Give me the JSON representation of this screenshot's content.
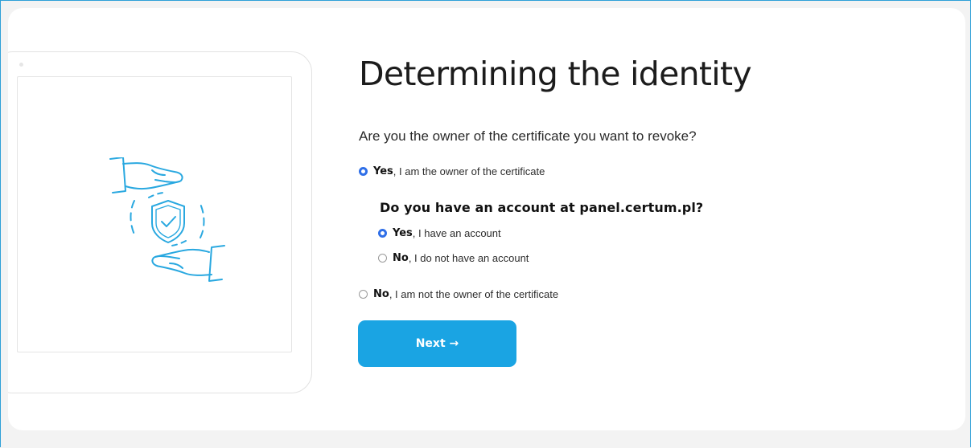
{
  "page": {
    "title": "Determining the identity",
    "question": "Are you the owner of the certificate you want to revoke?"
  },
  "owner_options": {
    "yes": {
      "bold": "Yes",
      "rest": ", I am the owner of the certificate",
      "checked": true
    },
    "no": {
      "bold": "No",
      "rest": ", I am not the owner of the certificate",
      "checked": false
    }
  },
  "account_question": "Do you have an account at panel.certum.pl?",
  "account_options": {
    "yes": {
      "bold": "Yes",
      "rest": ", I have an account",
      "checked": true
    },
    "no": {
      "bold": "No",
      "rest": ", I do not have an account",
      "checked": false
    }
  },
  "next_button": {
    "label": "Next →"
  },
  "illustration": {
    "icon": "hands-shield-check-icon",
    "color": "#29a8e0"
  },
  "colors": {
    "accent": "#1aa4e3",
    "radio_checked": "#2f6fe8",
    "frame_border": "#2ea0d8"
  }
}
